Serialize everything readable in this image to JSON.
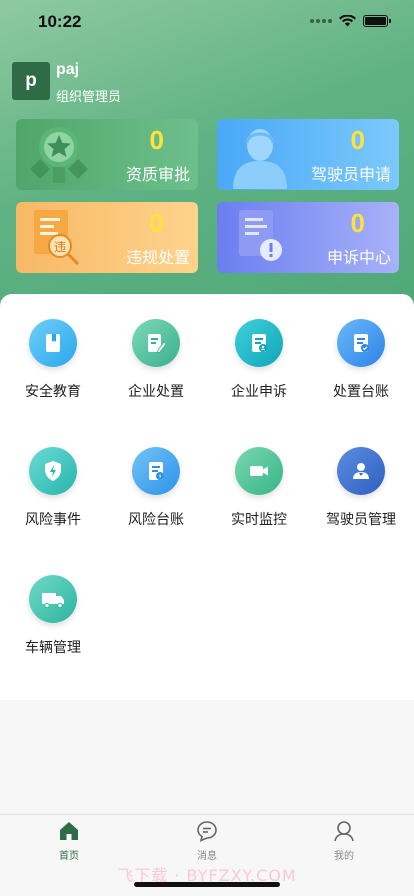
{
  "status_bar": {
    "time": "10:22"
  },
  "user": {
    "avatar_letter": "p",
    "name": "paj",
    "role": "组织管理员"
  },
  "stats": [
    {
      "value": "0",
      "label": "资质审批",
      "icon": "medal-icon",
      "color": "#4fa56a"
    },
    {
      "value": "0",
      "label": "驾驶员申请",
      "icon": "driver-person-icon",
      "color": "#4aa8f6"
    },
    {
      "value": "0",
      "label": "违规处置",
      "icon": "violation-document-icon",
      "color": "#f8b865"
    },
    {
      "value": "0",
      "label": "申诉中心",
      "icon": "appeal-document-icon",
      "color": "#6a7ef0"
    }
  ],
  "menu": [
    {
      "label": "安全教育",
      "icon": "book-icon",
      "color": "#3cb8f0"
    },
    {
      "label": "企业处置",
      "icon": "document-edit-icon",
      "color": "#4fc0a0"
    },
    {
      "label": "企业申诉",
      "icon": "document-user-icon",
      "color": "#1fb8c8"
    },
    {
      "label": "处置台账",
      "icon": "document-check-icon",
      "color": "#3d97f0"
    },
    {
      "label": "风险事件",
      "icon": "shield-bolt-icon",
      "color": "#3cc6c0"
    },
    {
      "label": "风险台账",
      "icon": "ledger-bolt-icon",
      "color": "#42a6f0"
    },
    {
      "label": "实时监控",
      "icon": "video-camera-icon",
      "color": "#4fc496"
    },
    {
      "label": "驾驶员管理",
      "icon": "driver-icon",
      "color": "#3a6fd0"
    },
    {
      "label": "车辆管理",
      "icon": "truck-icon",
      "color": "#44c6b4"
    }
  ],
  "tabbar": [
    {
      "label": "首页",
      "icon": "home-icon",
      "active": true
    },
    {
      "label": "消息",
      "icon": "chat-bubble-icon",
      "active": false
    },
    {
      "label": "我的",
      "icon": "user-icon",
      "active": false
    }
  ],
  "watermark": "飞下载 · BYFZXY.COM",
  "colors": {
    "primary": "#2f6b47",
    "stat_value": "#ffe33a"
  }
}
